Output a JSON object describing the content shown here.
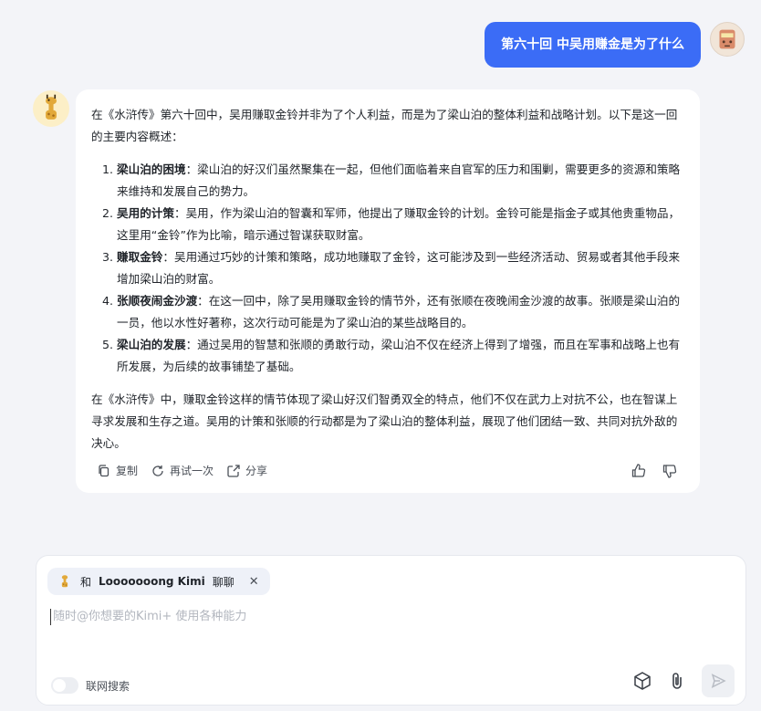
{
  "user_message": {
    "text": "第六十回 中吴用赚金是为了什么"
  },
  "bot": {
    "intro": "在《水浒传》第六十回中，吴用赚取金铃并非为了个人利益，而是为了梁山泊的整体利益和战略计划。以下是这一回的主要内容概述：",
    "items": [
      {
        "title": "梁山泊的困境",
        "text": "：梁山泊的好汉们虽然聚集在一起，但他们面临着来自官军的压力和围剿，需要更多的资源和策略来维持和发展自己的势力。"
      },
      {
        "title": "吴用的计策",
        "text": "：吴用，作为梁山泊的智囊和军师，他提出了赚取金铃的计划。金铃可能是指金子或其他贵重物品，这里用“金铃”作为比喻，暗示通过智谋获取财富。"
      },
      {
        "title": "赚取金铃",
        "text": "：吴用通过巧妙的计策和策略，成功地赚取了金铃，这可能涉及到一些经济活动、贸易或者其他手段来增加梁山泊的财富。"
      },
      {
        "title": "张顺夜闹金沙渡",
        "text": "：在这一回中，除了吴用赚取金铃的情节外，还有张顺在夜晚闹金沙渡的故事。张顺是梁山泊的一员，他以水性好著称，这次行动可能是为了梁山泊的某些战略目的。"
      },
      {
        "title": "梁山泊的发展",
        "text": "：通过吴用的智慧和张顺的勇敢行动，梁山泊不仅在经济上得到了增强，而且在军事和战略上也有所发展，为后续的故事铺垫了基础。"
      }
    ],
    "conclusion": "在《水浒传》中，赚取金铃这样的情节体现了梁山好汉们智勇双全的特点，他们不仅在武力上对抗不公，也在智谋上寻求发展和生存之道。吴用的计策和张顺的行动都是为了梁山泊的整体利益，展现了他们团结一致、共同对抗外敌的决心。",
    "actions": {
      "copy": "复制",
      "retry": "再试一次",
      "share": "分享"
    }
  },
  "composer": {
    "chip_prefix": "和",
    "chip_name": "Looooooong Kimi",
    "chip_suffix": "聊聊",
    "chip_close": "✕",
    "placeholder": "随时@你想要的Kimi+ 使用各种能力",
    "web_search_label": "联网搜索"
  },
  "icons": {
    "copy": "copy-icon",
    "retry": "refresh-icon",
    "share": "share-icon",
    "like": "thumbs-up-icon",
    "dislike": "thumbs-down-icon",
    "cube": "cube-icon",
    "attach": "paperclip-icon",
    "send": "send-icon"
  },
  "colors": {
    "accent": "#3b6cf6",
    "background": "#f3f4f8"
  }
}
